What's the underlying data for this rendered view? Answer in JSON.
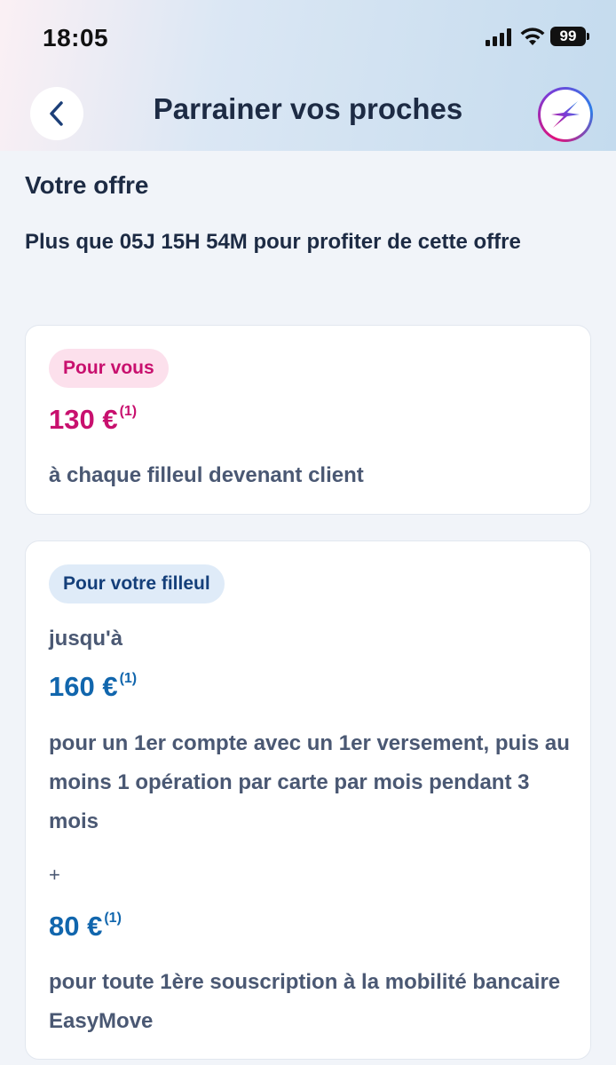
{
  "status_bar": {
    "time": "18:05",
    "battery": "99"
  },
  "header": {
    "title": "Parrainer vos proches",
    "back_icon": "chevron-left-icon",
    "action_icon": "sparkle-icon"
  },
  "offer": {
    "section_title": "Votre offre",
    "countdown": "Plus que 05J 15H 54M pour profiter de cette offre"
  },
  "card_you": {
    "chip": "Pour vous",
    "amount": "130 €",
    "footnote": "(1)",
    "description": "à chaque filleul devenant client"
  },
  "card_referral": {
    "chip": "Pour votre filleul",
    "prefix": "jusqu'à",
    "amount_1": "160 €",
    "footnote_1": "(1)",
    "description_1": "pour un 1er compte avec un 1er versement, puis au moins 1 opération par carte par mois pendant 3 mois",
    "plus": "+",
    "amount_2": "80 €",
    "footnote_2": "(1)",
    "description_2": "pour toute 1ère souscription à la mobilité bancaire EasyMove"
  },
  "colors": {
    "pink_accent": "#c8106e",
    "blue_accent": "#1166ad",
    "title": "#1d2b44"
  }
}
